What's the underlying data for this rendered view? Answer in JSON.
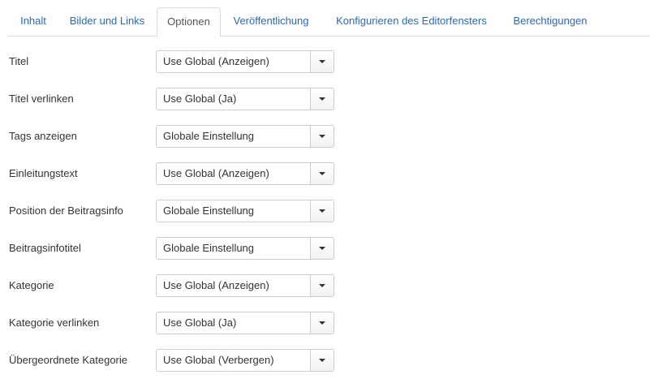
{
  "tabs": [
    {
      "label": "Inhalt",
      "active": false
    },
    {
      "label": "Bilder und Links",
      "active": false
    },
    {
      "label": "Optionen",
      "active": true
    },
    {
      "label": "Veröffentlichung",
      "active": false
    },
    {
      "label": "Konfigurieren des Editorfensters",
      "active": false
    },
    {
      "label": "Berechtigungen",
      "active": false
    }
  ],
  "fields": [
    {
      "label": "Titel",
      "value": "Use Global (Anzeigen)"
    },
    {
      "label": "Titel verlinken",
      "value": "Use Global (Ja)"
    },
    {
      "label": "Tags anzeigen",
      "value": "Globale Einstellung"
    },
    {
      "label": "Einleitungstext",
      "value": "Use Global (Anzeigen)"
    },
    {
      "label": "Position der Beitragsinfo",
      "value": "Globale Einstellung"
    },
    {
      "label": "Beitragsinfotitel",
      "value": "Globale Einstellung"
    },
    {
      "label": "Kategorie",
      "value": "Use Global (Anzeigen)"
    },
    {
      "label": "Kategorie verlinken",
      "value": "Use Global (Ja)"
    },
    {
      "label": "Übergeordnete Kategorie",
      "value": "Use Global (Verbergen)"
    }
  ],
  "icons": {
    "dropdown": "caret-down-icon"
  },
  "colors": {
    "tab_link": "#2a69b8",
    "tab_active_text": "#555555",
    "border": "#cccccc"
  }
}
